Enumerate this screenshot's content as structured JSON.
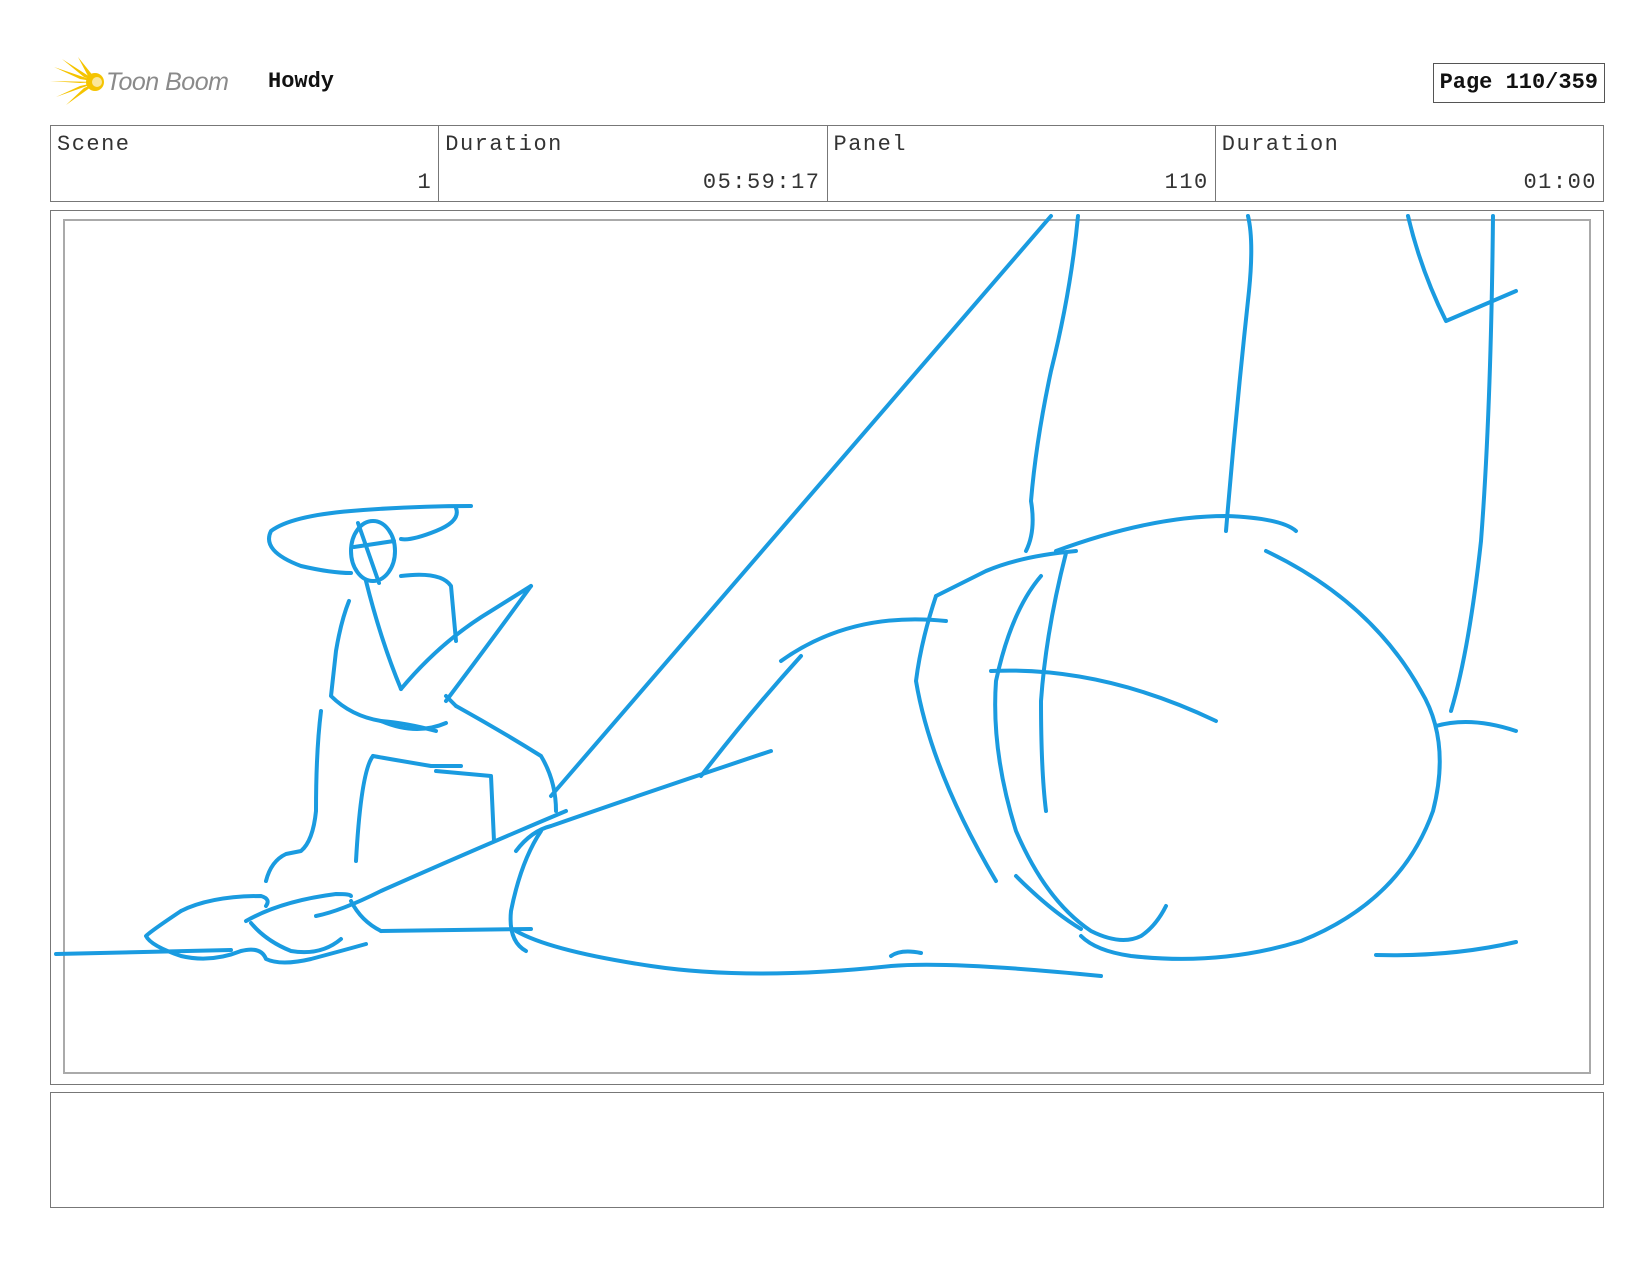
{
  "header": {
    "logo_text": "Toon Boom",
    "project_title": "Howdy",
    "page_label": "Page 110/359"
  },
  "info": {
    "scene_label": "Scene",
    "scene_value": "1",
    "scene_duration_label": "Duration",
    "scene_duration_value": "05:59:17",
    "panel_label": "Panel",
    "panel_value": "110",
    "panel_duration_label": "Duration",
    "panel_duration_value": "01:00"
  },
  "colors": {
    "sketch_line": "#1a9be0",
    "logo_yellow": "#f5c400"
  },
  "notes": {
    "text": ""
  }
}
